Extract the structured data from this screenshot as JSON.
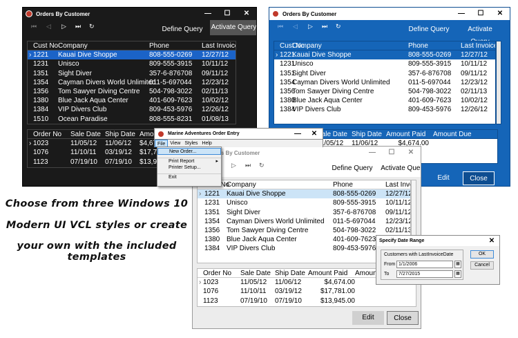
{
  "title": "Orders By Customer",
  "toolbar": {
    "define_query": "Define Query",
    "activate_query": "Activate Query"
  },
  "customer_headers": [
    "Cust No",
    "Company",
    "Phone",
    "Last Invoice"
  ],
  "customers": [
    [
      "1221",
      "Kauai Dive Shoppe",
      "808-555-0269",
      "12/27/12"
    ],
    [
      "1231",
      "Unisco",
      "809-555-3915",
      "10/11/12"
    ],
    [
      "1351",
      "Sight Diver",
      "357-6-876708",
      "09/11/12"
    ],
    [
      "1354",
      "Cayman Divers World Unlimited",
      "011-5-697044",
      "12/23/12"
    ],
    [
      "1356",
      "Tom Sawyer Diving Centre",
      "504-798-3022",
      "02/11/13"
    ],
    [
      "1380",
      "Blue Jack Aqua Center",
      "401-609-7623",
      "10/02/12"
    ],
    [
      "1384",
      "VIP Divers Club",
      "809-453-5976",
      "12/26/12"
    ],
    [
      "1510",
      "Ocean Paradise",
      "808-555-8231",
      "01/08/13"
    ]
  ],
  "order_headers": [
    "Order No",
    "Sale Date",
    "Ship Date",
    "Amount Paid",
    "Amount Due"
  ],
  "orders": [
    [
      "1023",
      "11/05/12",
      "11/06/12",
      "$4,674.00",
      ""
    ],
    [
      "1076",
      "11/10/11",
      "03/19/12",
      "$17,781.00",
      ""
    ],
    [
      "1123",
      "07/19/10",
      "07/19/10",
      "$13,945.00",
      ""
    ]
  ],
  "buttons": {
    "edit": "Edit",
    "close": "Close"
  },
  "menu_window": {
    "title": "Marine Adventures Order Entry",
    "menubar": [
      "File",
      "View",
      "Styles",
      "Help"
    ],
    "items": [
      "New Order...",
      "Print Report",
      "Printer Setup...",
      "Exit"
    ]
  },
  "caption": [
    "Choose from three Windows 10",
    "Modern UI VCL styles or create",
    "your own with the included templates"
  ],
  "dialog": {
    "title": "Specify Date Range",
    "group": "Customers with LastInvoiceDate",
    "from_label": "From",
    "from_value": "1/1/2006",
    "to_label": "To",
    "to_value": "7/27/2015",
    "ok": "OK",
    "cancel": "Cancel"
  },
  "colors": {
    "dark_bg": "#1a1a1a",
    "blue_bg": "#1565b8",
    "light_bg": "#ececec",
    "select_dark": "#1b63c7",
    "select_light": "#cce4f7"
  }
}
